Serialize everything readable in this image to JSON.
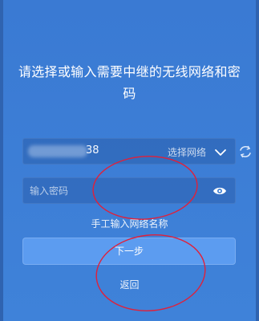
{
  "title": "请选择或输入需要中继的无线网络和密码",
  "wifi_field": {
    "value_visible_suffix": "38",
    "select_label": "选择网络",
    "icon": "chevron-down-icon"
  },
  "refresh": {
    "icon": "refresh-icon"
  },
  "password_field": {
    "placeholder": "输入密码",
    "value": "",
    "icon": "eye-icon"
  },
  "manual_entry_label": "手工输入网络名称",
  "next_label": "下一步",
  "back_label": "返回",
  "colors": {
    "background": "#3c7fd6",
    "button": "#5c9cf0",
    "annotation_red": "#e0203a"
  }
}
